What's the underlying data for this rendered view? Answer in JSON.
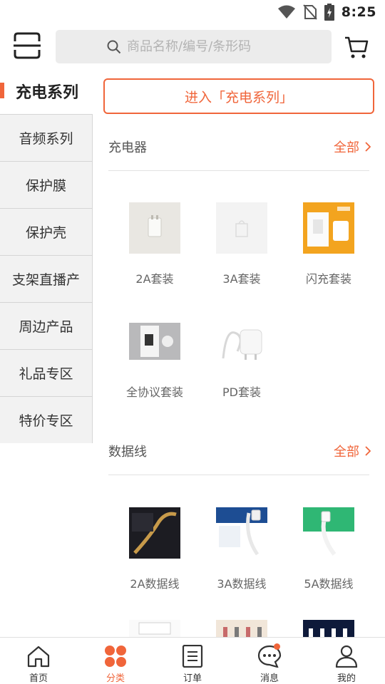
{
  "status_bar": {
    "time": "8:25"
  },
  "search": {
    "placeholder": "商品名称/编号/条形码"
  },
  "sidebar": {
    "active": "充电系列",
    "items": [
      "音频系列",
      "保护膜",
      "保护壳",
      "支架直播产",
      "周边产品",
      "礼品专区",
      "特价专区"
    ]
  },
  "main": {
    "enter_label": "进入「充电系列」",
    "sections": [
      {
        "title": "充电器",
        "more": "全部",
        "products": [
          "2A套装",
          "3A套装",
          "闪充套装",
          "全协议套装",
          "PD套装"
        ]
      },
      {
        "title": "数据线",
        "more": "全部",
        "products": [
          "2A数据线",
          "3A数据线",
          "5A数据线"
        ]
      }
    ]
  },
  "bottom_nav": [
    {
      "label": "首页",
      "icon": "home-icon"
    },
    {
      "label": "分类",
      "icon": "category-icon"
    },
    {
      "label": "订单",
      "icon": "order-icon"
    },
    {
      "label": "消息",
      "icon": "message-icon"
    },
    {
      "label": "我的",
      "icon": "profile-icon"
    }
  ],
  "colors": {
    "accent": "#f0653a",
    "sidebar_bg": "#f2f2f2",
    "search_bg": "#ececec"
  }
}
